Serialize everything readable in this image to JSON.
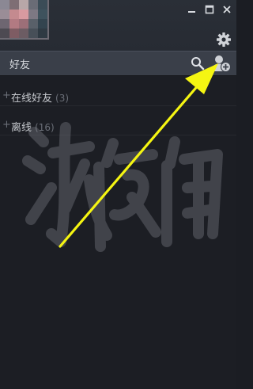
{
  "search_bar": {
    "title": "好友"
  },
  "groups": [
    {
      "label": "在线好友",
      "count": "(3)"
    },
    {
      "label": "离线",
      "count": "(16)"
    }
  ],
  "colors": {
    "background": "#1c1e24",
    "header": "#2a2f37",
    "search_bar": "#3a3f49",
    "arrow": "#f5f512"
  },
  "icons": {
    "minimize": "minimize-icon",
    "maximize": "maximize-icon",
    "close": "close-icon",
    "settings": "gear-icon",
    "search": "search-icon",
    "add_friend": "add-friend-icon"
  }
}
